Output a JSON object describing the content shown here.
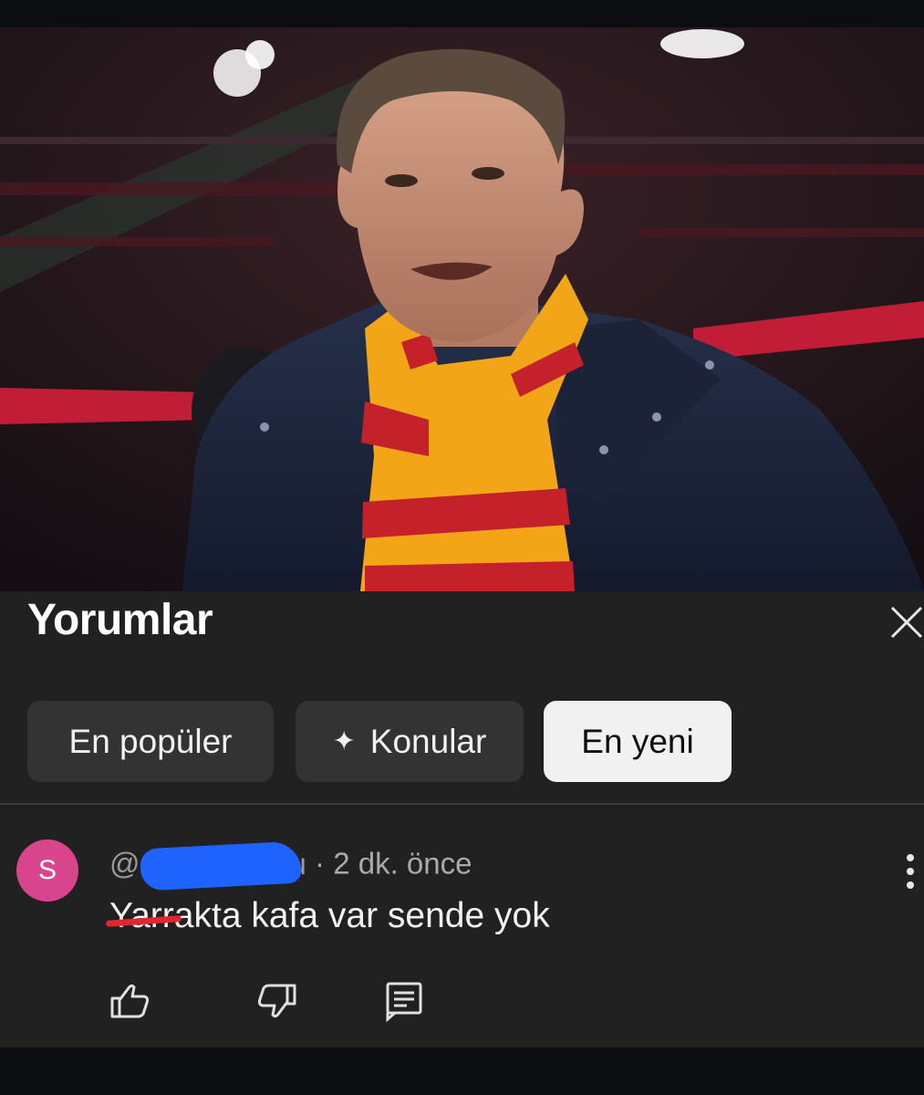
{
  "comments_panel": {
    "title": "Yorumlar",
    "close_icon": "close-icon"
  },
  "filters": [
    {
      "label": "En popüler",
      "icon": "",
      "active": false
    },
    {
      "label": "Konular",
      "icon": "sparkle-icon",
      "active": false
    },
    {
      "label": "En yeni",
      "icon": "",
      "active": true
    }
  ],
  "comment": {
    "avatar_letter": "S",
    "avatar_color": "#d9458c",
    "handle_prefix": "@",
    "handle_visible_suffix": "u",
    "time": "· 2 dk. önce",
    "text_scribbled": "Yarr",
    "text_rest": "akta kafa var sende yok",
    "redaction_color": "#1f63ff",
    "scribble_color": "#e0262f"
  },
  "actions": {
    "like_icon": "thumbs-up-icon",
    "dislike_icon": "thumbs-down-icon",
    "reply_icon": "reply-icon"
  },
  "colors": {
    "panel_bg": "#212121",
    "chip_bg": "#333333",
    "chip_active_bg": "#f1f1f1"
  }
}
